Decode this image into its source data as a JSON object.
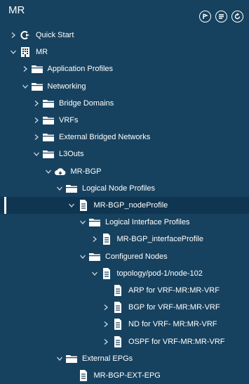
{
  "header": {
    "title": "MR"
  },
  "header_buttons": [
    "tag-icon",
    "list-icon",
    "refresh-icon"
  ],
  "tree": {
    "quick_start": "Quick Start",
    "mr": "MR",
    "application_profiles": "Application Profiles",
    "networking": "Networking",
    "bridge_domains": "Bridge Domains",
    "vrfs": "VRFs",
    "external_bridged_networks": "External Bridged Networks",
    "l3outs": "L3Outs",
    "mr_bgp": "MR-BGP",
    "logical_node_profiles": "Logical Node Profiles",
    "mr_bgp_node_profile": "MR-BGP_nodeProfile",
    "logical_interface_profiles": "Logical Interface Profiles",
    "mr_bgp_interface_profile": "MR-BGP_interfaceProfile",
    "configured_nodes": "Configured Nodes",
    "topology_node": "topology/pod-1/node-102",
    "arp_vrf": "ARP for VRF-MR:MR-VRF",
    "bgp_vrf": "BGP for VRF-MR:MR-VRF",
    "nd_vrf": "ND for VRF- MR:MR-VRF",
    "ospf_vrf": "OSPF for VRF-MR:MR-VRF",
    "external_epgs": "External EPGs",
    "mr_bgp_ext_epg": "MR-BGP-EXT-EPG"
  },
  "colors": {
    "background": "#17425f",
    "selected": "#0f3550",
    "text": "#ffffff"
  }
}
